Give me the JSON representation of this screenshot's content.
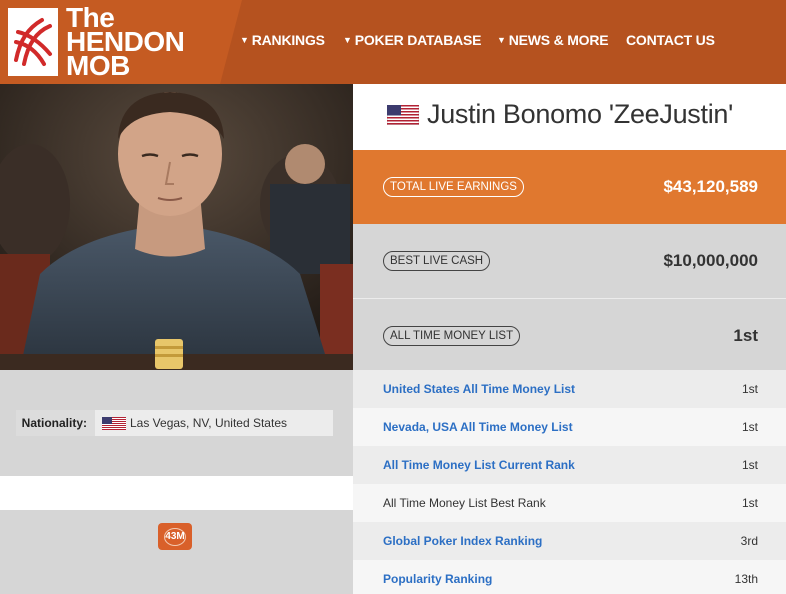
{
  "brand": {
    "logo_line1": "The",
    "logo_line2": "HENDON",
    "logo_line3": "MOB",
    "header_color": "#b5521f",
    "accent_color": "#e0782f",
    "link_color": "#2c6fc4"
  },
  "nav": {
    "items": [
      {
        "label": "RANKINGS",
        "has_dropdown": true
      },
      {
        "label": "POKER DATABASE",
        "has_dropdown": true
      },
      {
        "label": "NEWS & MORE",
        "has_dropdown": true
      },
      {
        "label": "CONTACT US",
        "has_dropdown": false
      }
    ],
    "caret_icon": "caret-down-icon"
  },
  "player": {
    "name": "Justin Bonomo 'ZeeJustin'",
    "flag_icon": "us-flag-icon",
    "photo_icon": "player-photo",
    "nationality_label": "Nationality:",
    "nationality_value": "Las Vegas, NV, United States",
    "badge_text": "43M"
  },
  "stats": {
    "total_live_earnings_label": "TOTAL LIVE EARNINGS",
    "total_live_earnings_value": "$43,120,589",
    "best_live_cash_label": "BEST LIVE CASH",
    "best_live_cash_value": "$10,000,000",
    "all_time_money_list_label": "ALL TIME MONEY LIST",
    "all_time_money_list_value": "1st"
  },
  "rankings": [
    {
      "label": "United States All Time Money List",
      "value": "1st",
      "link": true
    },
    {
      "label": "Nevada, USA All Time Money List",
      "value": "1st",
      "link": true
    },
    {
      "label": "All Time Money List Current Rank",
      "value": "1st",
      "link": true
    },
    {
      "label": "All Time Money List Best Rank",
      "value": "1st",
      "link": false
    },
    {
      "label": "Global Poker Index Ranking",
      "value": "3rd",
      "link": true
    },
    {
      "label": "Popularity Ranking",
      "value": "13th",
      "link": true
    }
  ]
}
